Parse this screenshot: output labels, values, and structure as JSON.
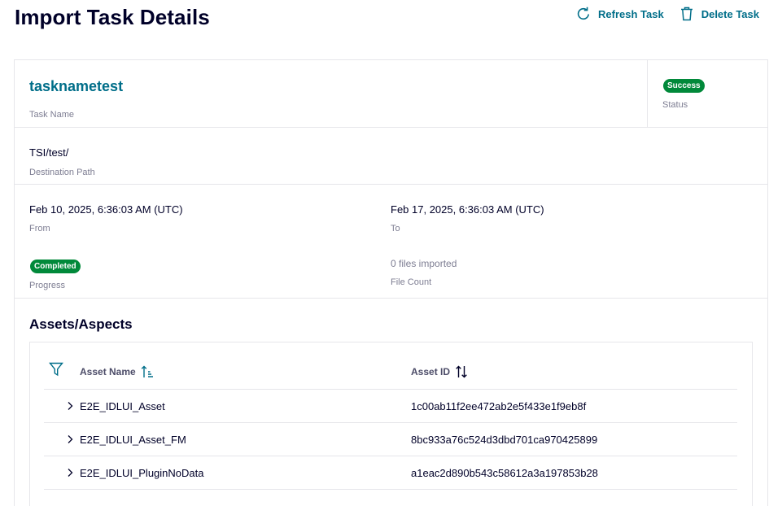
{
  "header": {
    "title": "Import Task Details",
    "refresh_label": "Refresh Task",
    "delete_label": "Delete Task"
  },
  "task": {
    "name": "tasknametest",
    "name_caption": "Task Name",
    "status": "Success",
    "status_caption": "Status",
    "destination_path": "TSI/test/",
    "destination_caption": "Destination Path",
    "from": "Feb 10, 2025, 6:36:03 AM (UTC)",
    "from_caption": "From",
    "to": "Feb 17, 2025, 6:36:03 AM (UTC)",
    "to_caption": "To",
    "progress": "Completed",
    "progress_caption": "Progress",
    "file_count": "0 files imported",
    "file_count_caption": "File Count"
  },
  "assets": {
    "section_title": "Assets/Aspects",
    "columns": {
      "name": "Asset Name",
      "id": "Asset ID"
    },
    "rows": [
      {
        "name": "E2E_IDLUI_Asset",
        "id": "1c00ab11f2ee472ab2e5f433e1f9eb8f"
      },
      {
        "name": "E2E_IDLUI_Asset_FM",
        "id": "8bc933a76c524d3dbd701ca970425899"
      },
      {
        "name": "E2E_IDLUI_PluginNoData",
        "id": "a1eac2d890b543c58612a3a197853b28"
      }
    ]
  },
  "colors": {
    "accent": "#006e89",
    "success": "#01893a",
    "text": "#000028",
    "caption": "#7d7d92",
    "border": "#e6e6ea"
  },
  "icons": {
    "refresh": "refresh-icon",
    "delete": "trash-icon",
    "filter": "filter-icon",
    "sort_active": "sort-ascending-icon",
    "sort_inactive": "sort-icon",
    "expand": "chevron-right-icon"
  }
}
